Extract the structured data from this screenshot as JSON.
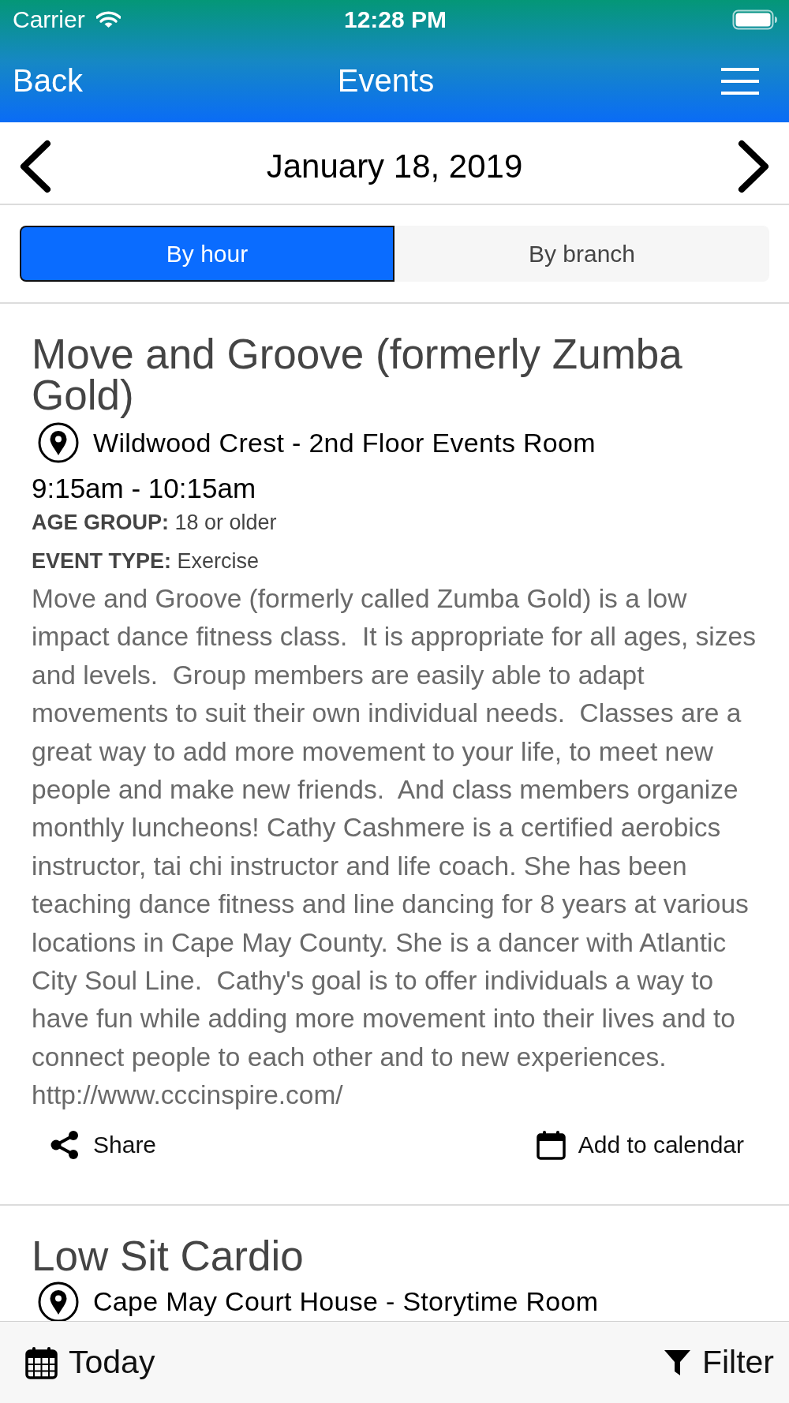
{
  "status_bar": {
    "carrier": "Carrier",
    "time": "12:28 PM"
  },
  "nav_bar": {
    "back": "Back",
    "title": "Events"
  },
  "date_nav": {
    "date": "January 18, 2019"
  },
  "view_tabs": [
    {
      "label": "By hour",
      "selected": true
    },
    {
      "label": "By branch",
      "selected": false
    }
  ],
  "events": [
    {
      "title": "Move and Groove (formerly Zumba Gold)",
      "location": "Wildwood Crest - 2nd Floor Events Room",
      "time": "9:15am - 10:15am",
      "details": [
        "**AGE GROUP:** 18 or older",
        "**EVENT TYPE:** Exercise"
      ],
      "description": "Move and Groove (formerly called Zumba Gold) is a low impact dance fitness class.  It is appropriate for all ages, sizes and levels.  Group members are easily able to adapt movements to suit their own individual needs.  Classes are a great way to add more movement to your life, to meet new people and make new friends.  And class members organize monthly luncheons! Cathy Cashmere is a certified aerobics instructor, tai chi instructor and life coach. She has been teaching dance fitness and line dancing for 8 years at various locations in Cape May County. She is a dancer with Atlantic City Soul Line.  Cathy's goal is to offer individuals a way to have fun while adding more movement into their lives and to connect people to each other and to new experiences.    http://www.cccinspire.com/",
      "actions": [
        {
          "kind": "share",
          "label": "Share"
        },
        {
          "kind": "calendar",
          "label": "Add to calendar"
        }
      ]
    },
    {
      "title": "Low Sit Cardio",
      "location": "Cape May Court House - Storytime Room"
    }
  ],
  "toolbar": [
    {
      "kind": "today",
      "label": "Today"
    },
    {
      "kind": "filter",
      "label": "Filter"
    }
  ]
}
